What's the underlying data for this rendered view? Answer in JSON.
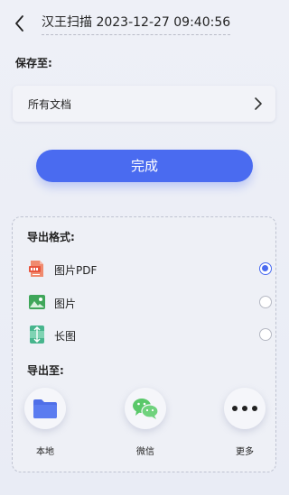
{
  "header": {
    "title": "汉王扫描 2023-12-27 09:40:56"
  },
  "save_to": {
    "label": "保存至:",
    "location": "所有文档"
  },
  "done_button": "完成",
  "export_format": {
    "label": "导出格式:",
    "options": [
      {
        "name": "图片PDF",
        "icon": "pdf-icon",
        "selected": true
      },
      {
        "name": "图片",
        "icon": "image-icon",
        "selected": false
      },
      {
        "name": "长图",
        "icon": "long-image-icon",
        "selected": false
      }
    ]
  },
  "export_to": {
    "label": "导出至:",
    "destinations": [
      {
        "name": "本地",
        "icon": "folder-icon"
      },
      {
        "name": "微信",
        "icon": "wechat-icon"
      },
      {
        "name": "更多",
        "icon": "more-icon"
      }
    ]
  },
  "colors": {
    "accent": "#4a6bf0",
    "folder": "#4f6fe8",
    "wechat": "#5ac86a",
    "pdf": "#e8553d",
    "image": "#3fa65a",
    "long_image": "#47b58d"
  }
}
